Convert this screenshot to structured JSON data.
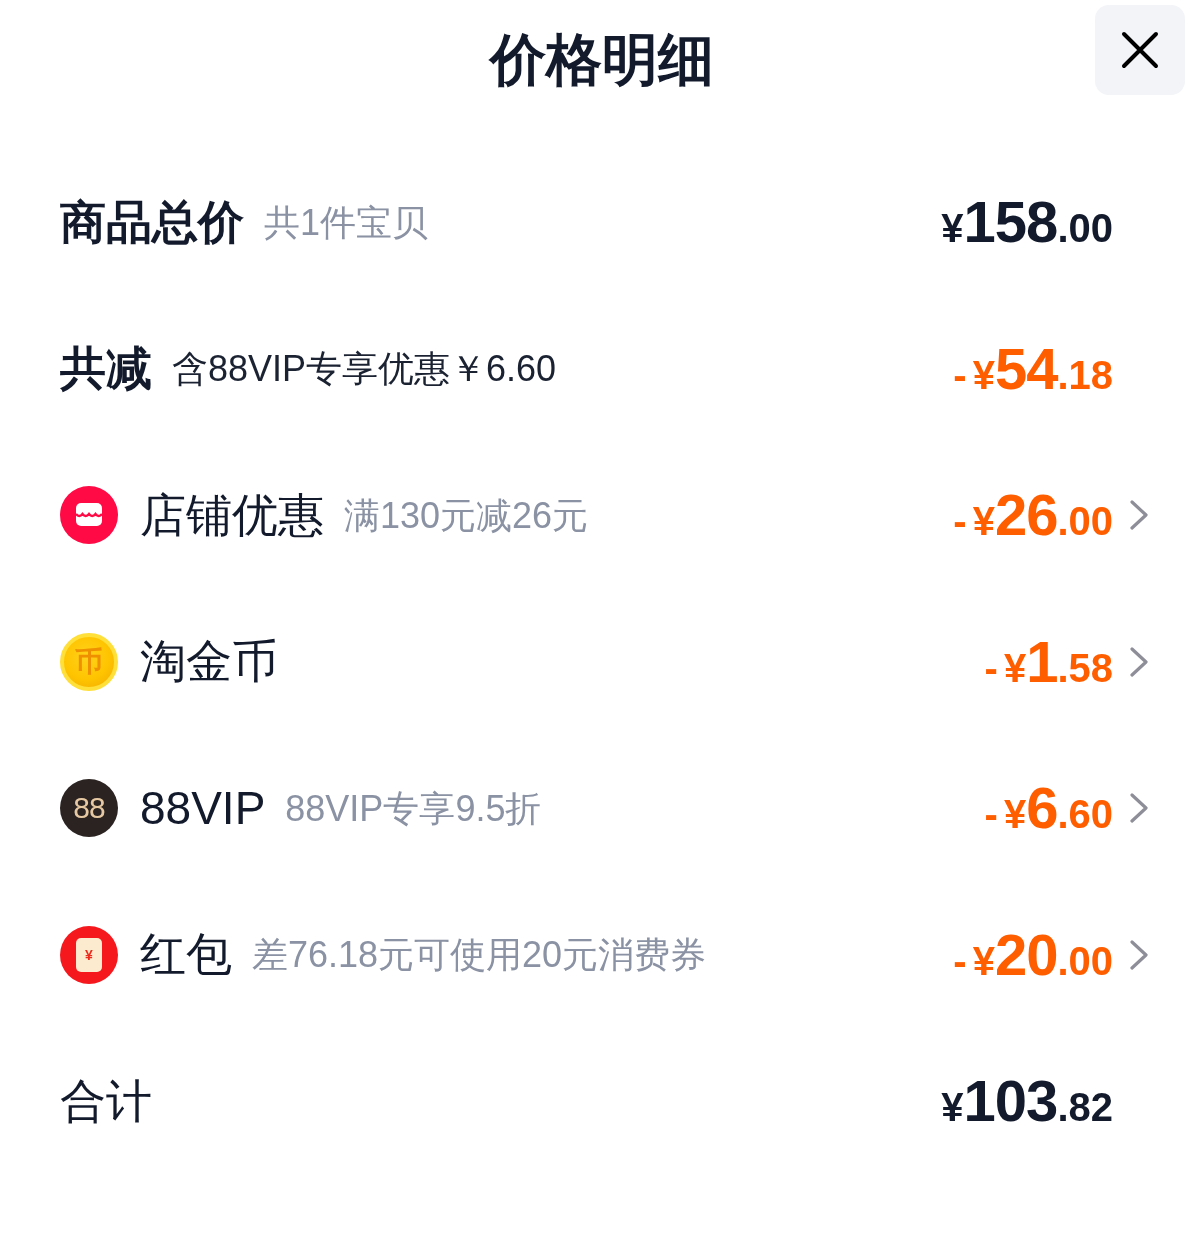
{
  "title": "价格明细",
  "rows": [
    {
      "kind": "subtotal",
      "label": "商品总价",
      "note": "共1件宝贝",
      "amount": {
        "currency": "¥",
        "integer": "158",
        "decimal": ".00"
      }
    },
    {
      "kind": "discount_total",
      "label": "共减",
      "note": "含88VIP专享优惠￥6.60",
      "amount": {
        "sign": "-",
        "currency": "¥",
        "integer": "54",
        "decimal": ".18"
      }
    },
    {
      "kind": "shop",
      "label": "店铺优惠",
      "note": "满130元减26元",
      "amount": {
        "sign": "-",
        "currency": "¥",
        "integer": "26",
        "decimal": ".00"
      }
    },
    {
      "kind": "coin",
      "badge": "币",
      "label": "淘金币",
      "amount": {
        "sign": "-",
        "currency": "¥",
        "integer": "1",
        "decimal": ".58"
      }
    },
    {
      "kind": "vip",
      "badge": "88",
      "label": "88VIP",
      "note": "88VIP专享9.5折",
      "amount": {
        "sign": "-",
        "currency": "¥",
        "integer": "6",
        "decimal": ".60"
      }
    },
    {
      "kind": "red_packet",
      "badge": "¥",
      "label": "红包",
      "note": "差76.18元可使用20元消费券",
      "amount": {
        "sign": "-",
        "currency": "¥",
        "integer": "20",
        "decimal": ".00"
      }
    },
    {
      "kind": "total",
      "label": "合计",
      "amount": {
        "currency": "¥",
        "integer": "103",
        "decimal": ".82"
      }
    }
  ]
}
